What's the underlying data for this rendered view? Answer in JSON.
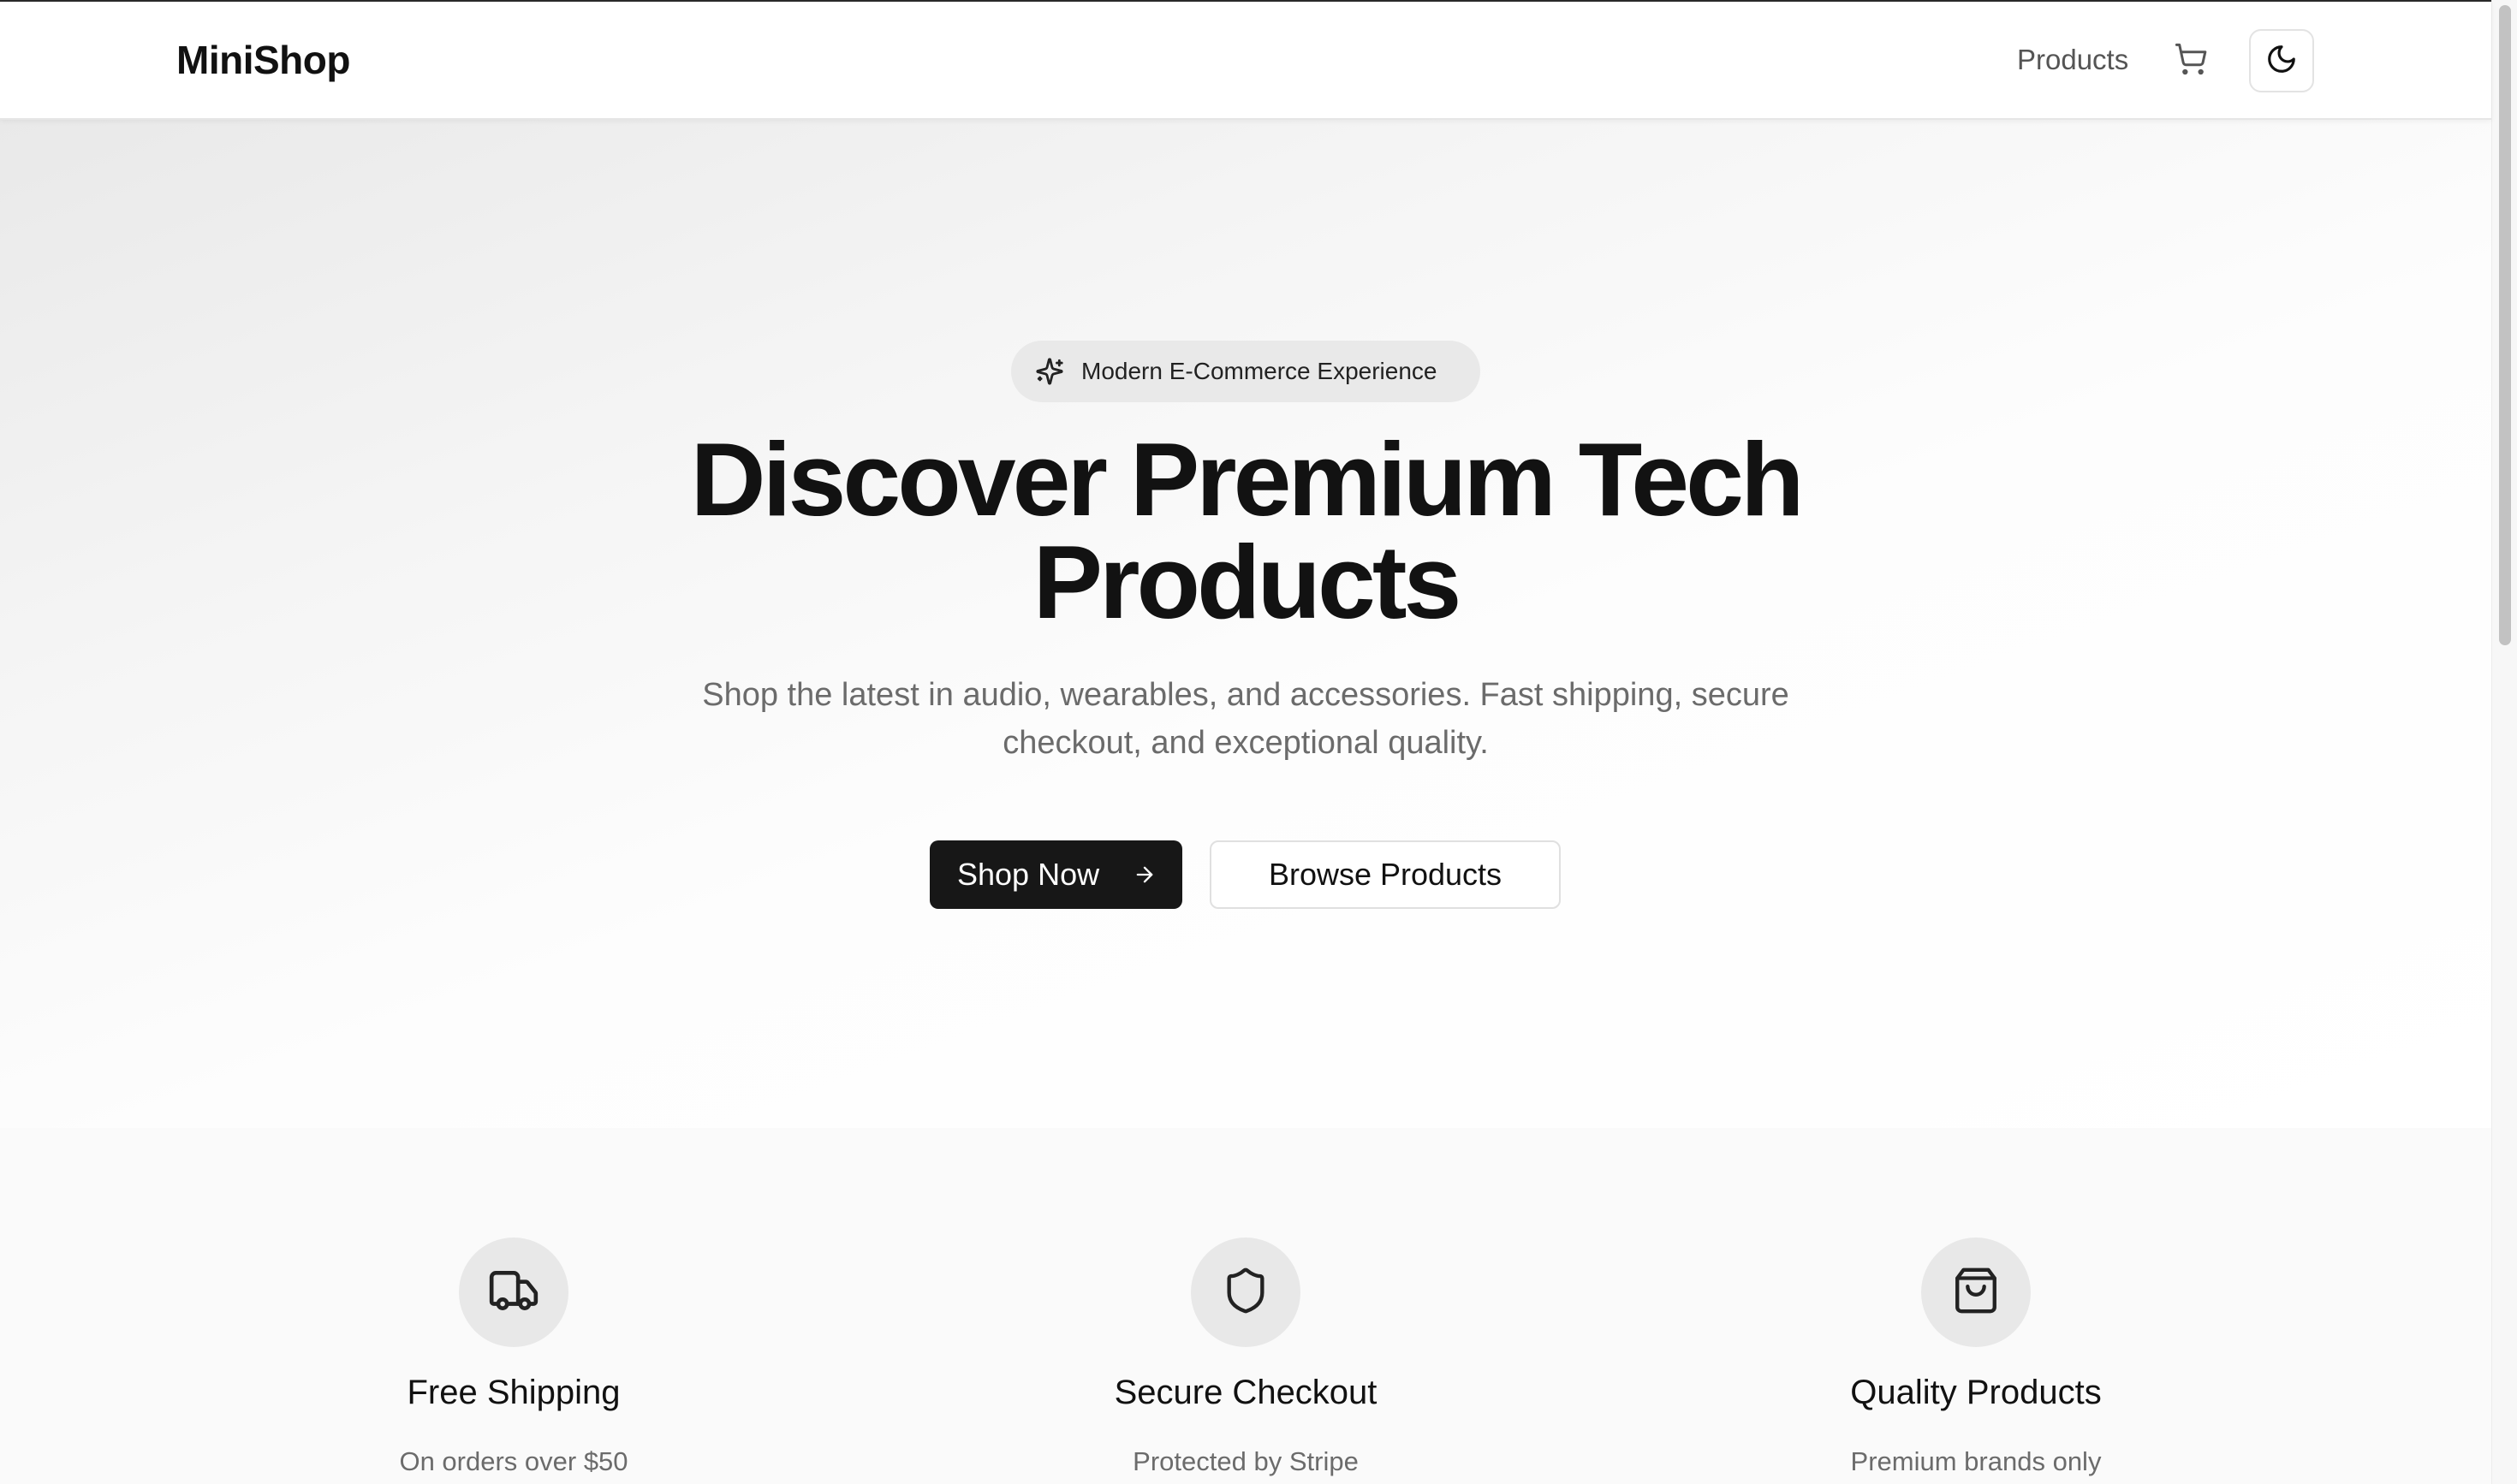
{
  "header": {
    "logo": "MiniShop",
    "nav_products": "Products",
    "cart_icon": "cart-icon",
    "theme_icon": "moon-icon"
  },
  "hero": {
    "badge_icon": "sparkles-icon",
    "badge_text": "Modern E-Commerce Experience",
    "title_line1": "Discover Premium Tech",
    "title_line2": "Products",
    "subtitle_line1": "Shop the latest in audio, wearables, and accessories. Fast shipping, secure",
    "subtitle_line2": "checkout, and exceptional quality.",
    "primary_button": "Shop Now",
    "primary_button_icon": "arrow-right-icon",
    "secondary_button": "Browse Products"
  },
  "features": [
    {
      "icon": "truck-icon",
      "title": "Free Shipping",
      "description": "On orders over $50"
    },
    {
      "icon": "shield-icon",
      "title": "Secure Checkout",
      "description": "Protected by Stripe"
    },
    {
      "icon": "shopping-bag-icon",
      "title": "Quality Products",
      "description": "Premium brands only"
    }
  ],
  "colors": {
    "primary_button_bg": "#171717",
    "text_primary": "#111111",
    "text_muted": "#6b6b6b",
    "badge_bg": "#e9e9e9",
    "feature_icon_bg": "#e8e8e8"
  }
}
